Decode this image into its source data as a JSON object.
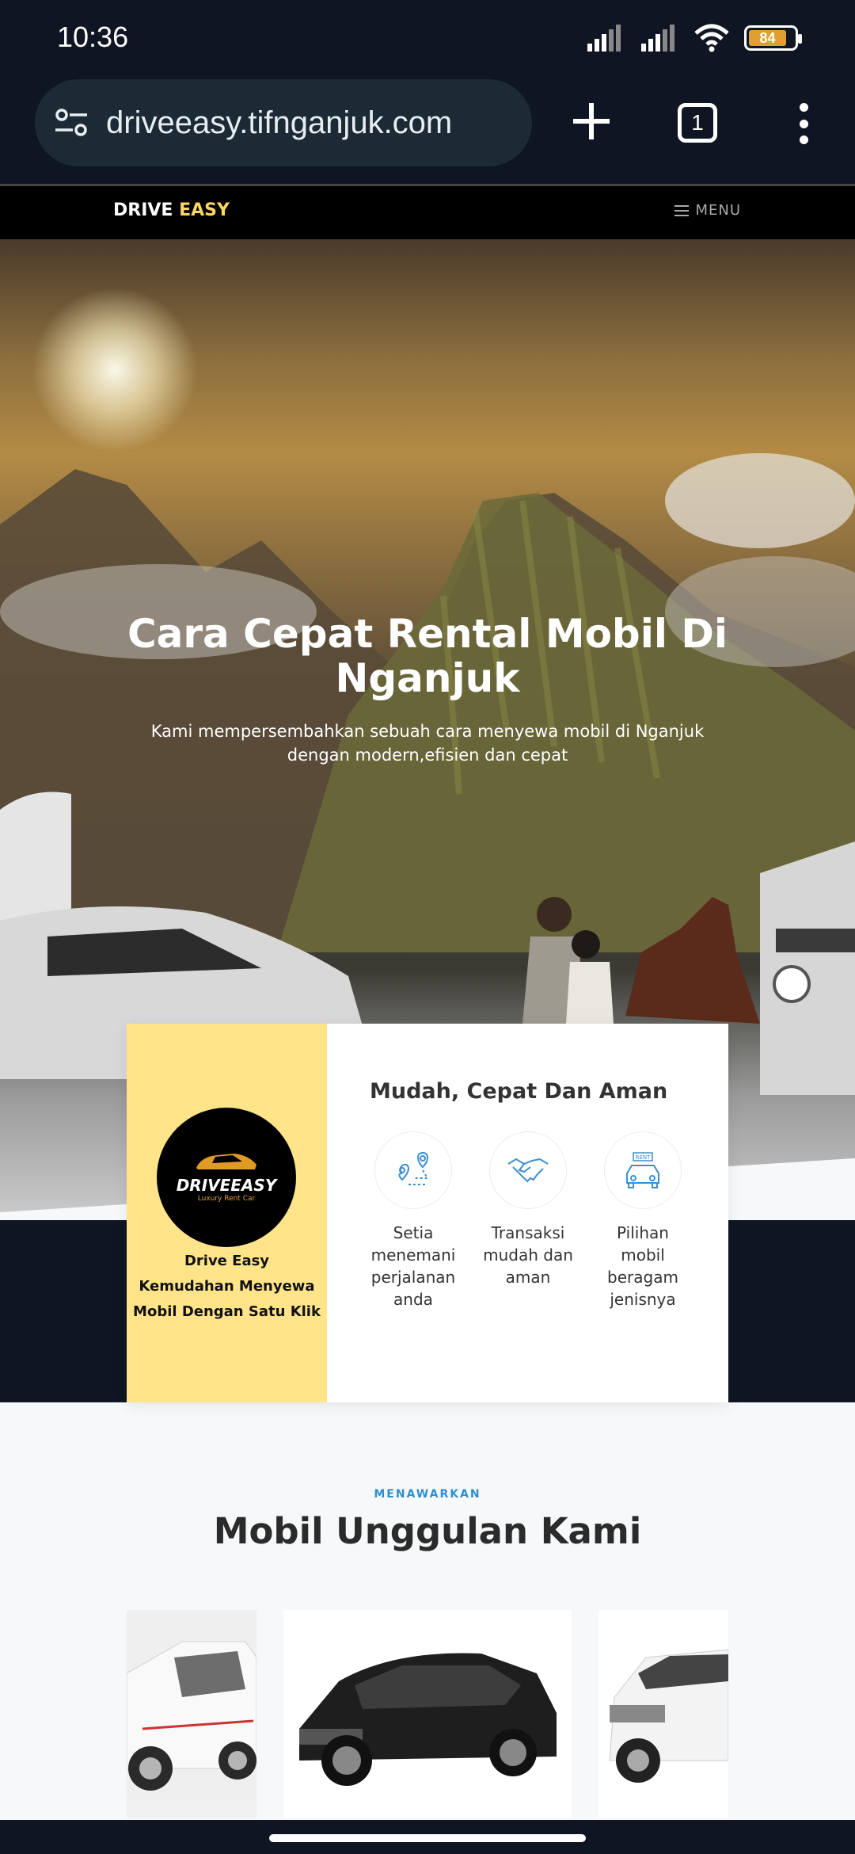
{
  "status": {
    "time": "10:36",
    "battery": "84",
    "icons": [
      "signal-icon",
      "signal-icon",
      "wifi-icon",
      "battery-icon"
    ]
  },
  "browser": {
    "url": "driveeasy.tifnganjuk.com",
    "tab_count": "1"
  },
  "nav": {
    "logo_part1": "DRIVE ",
    "logo_part2": "EASY",
    "menu_label": "MENU"
  },
  "hero": {
    "title": "Cara Cepat Rental Mobil Di Nganjuk",
    "subtitle": "Kami mempersembahkan sebuah cara menyewa mobil di Nganjuk dengan modern,efisien dan cepat"
  },
  "card": {
    "brand_word": "DRIVEEASY",
    "brand_tag": "Luxury Rent Car",
    "left_line1": "Drive Easy",
    "left_line2": "Kemudahan Menyewa",
    "left_line3": "Mobil Dengan Satu Klik",
    "heading": "Mudah, Cepat Dan Aman",
    "features": [
      {
        "icon": "route-icon",
        "text": "Setia menemani perjalanan anda"
      },
      {
        "icon": "handshake-icon",
        "text": "Transaksi mudah dan aman"
      },
      {
        "icon": "rent-car-icon",
        "text": "Pilihan mobil beragam jenisnya",
        "badge": "RENT"
      }
    ]
  },
  "section": {
    "kicker": "MENAWARKAN",
    "title": "Mobil Unggulan Kami"
  },
  "colors": {
    "accent_yellow": "#ffe48a",
    "logo_accent": "#ffd75e",
    "kicker_blue": "#2f8fd0",
    "chrome_bg": "#0f1523"
  }
}
